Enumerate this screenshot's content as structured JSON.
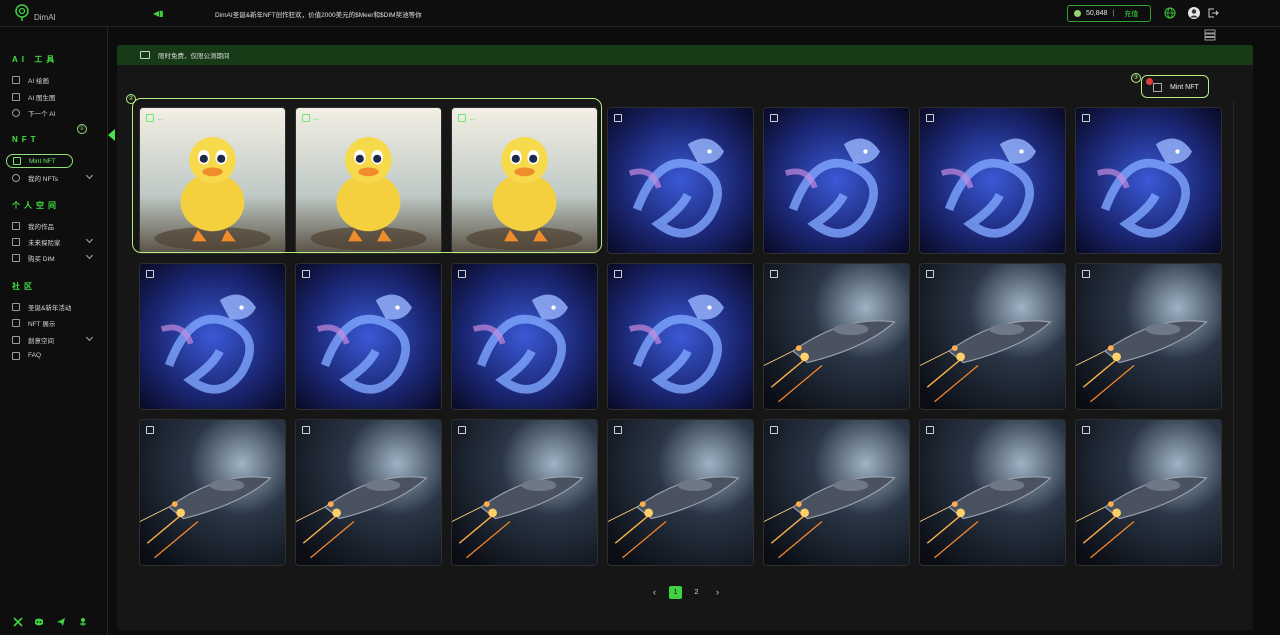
{
  "app": {
    "name": "DimAI"
  },
  "topbar": {
    "announcement": "DimAI圣诞&新年NFT创作狂欢，价值2000美元的$Meer和$DIM奖池等你",
    "balance": "50,848",
    "separator": "|",
    "recharge_label": "充值",
    "icons": [
      "globe-icon",
      "user-avatar",
      "logout-icon"
    ]
  },
  "sidebar": {
    "sections": [
      {
        "title": "AI 工具",
        "items": [
          {
            "label": "AI 绘画",
            "icon": "palette-icon"
          },
          {
            "label": "AI 图生图",
            "icon": "image-icon"
          },
          {
            "label": "下一个 AI",
            "icon": "compass-icon"
          }
        ]
      },
      {
        "title": "NFT",
        "items": [
          {
            "label": "Mint NFT",
            "icon": "mint-icon",
            "active": true
          },
          {
            "label": "我的 NFTs",
            "icon": "nft-icon",
            "expandable": true
          }
        ]
      },
      {
        "title": "个人空间",
        "items": [
          {
            "label": "我的作品",
            "icon": "works-icon"
          },
          {
            "label": "未来探险家",
            "icon": "explorer-icon",
            "expandable": true
          },
          {
            "label": "购买 DIM",
            "icon": "cart-icon",
            "expandable": true
          }
        ]
      },
      {
        "title": "社区",
        "items": [
          {
            "label": "圣诞&新年活动",
            "icon": "gift-icon"
          },
          {
            "label": "NFT 展示",
            "icon": "showcase-icon"
          },
          {
            "label": "創意空间",
            "icon": "space-icon",
            "expandable": true
          },
          {
            "label": "FAQ",
            "icon": "faq-icon"
          }
        ]
      }
    ],
    "social": [
      "x-icon",
      "discord-icon",
      "telegram-icon",
      "medium-icon"
    ]
  },
  "main": {
    "notice": "限时免费，仅限公测期间",
    "mint_button": "Mint NFT",
    "callouts": [
      "①",
      "②",
      "③"
    ],
    "pagination": {
      "current": "1",
      "pages": [
        "1",
        "2"
      ]
    }
  },
  "gallery": [
    {
      "type": "duck",
      "selected": true
    },
    {
      "type": "duck",
      "selected": true
    },
    {
      "type": "duck",
      "selected": true
    },
    {
      "type": "dragon"
    },
    {
      "type": "dragon"
    },
    {
      "type": "dragon"
    },
    {
      "type": "dragon"
    },
    {
      "type": "dragon"
    },
    {
      "type": "dragon"
    },
    {
      "type": "dragon"
    },
    {
      "type": "dragon"
    },
    {
      "type": "ship"
    },
    {
      "type": "ship"
    },
    {
      "type": "ship"
    },
    {
      "type": "ship"
    },
    {
      "type": "ship"
    },
    {
      "type": "ship"
    },
    {
      "type": "ship"
    },
    {
      "type": "ship"
    },
    {
      "type": "ship"
    },
    {
      "type": "ship"
    }
  ],
  "colors": {
    "accent": "#3fd13f",
    "highlight": "#b6ef7f",
    "notice_bg": "#163b16"
  }
}
